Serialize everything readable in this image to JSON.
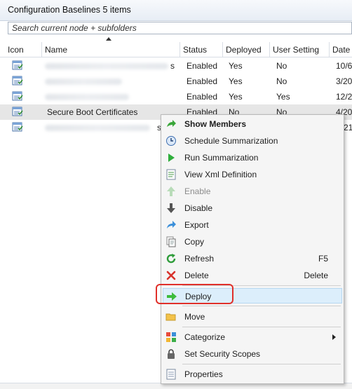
{
  "window": {
    "title": "Configuration Baselines 5 items"
  },
  "search": {
    "placeholder": "Search current node + subfolders"
  },
  "table": {
    "columns": [
      "Icon",
      "Name",
      "Status",
      "Deployed",
      "User Setting",
      "Date"
    ],
    "rows": [
      {
        "name": "",
        "name_suffix": "s",
        "status": "Enabled",
        "deployed": "Yes",
        "user_setting": "No",
        "date": "10/6"
      },
      {
        "name": "",
        "name_suffix": "",
        "status": "Enabled",
        "deployed": "Yes",
        "user_setting": "No",
        "date": "3/20"
      },
      {
        "name": "",
        "name_suffix": "",
        "status": "Enabled",
        "deployed": "Yes",
        "user_setting": "Yes",
        "date": "12/2"
      },
      {
        "name": "Secure Boot Certificates",
        "name_suffix": "",
        "status": "Enabled",
        "deployed": "No",
        "user_setting": "No",
        "date": "4/20"
      },
      {
        "name": "",
        "name_suffix": "s",
        "status": "",
        "deployed": "",
        "user_setting": "",
        "date": "21"
      }
    ]
  },
  "context_menu": {
    "items": [
      {
        "label": "Show Members",
        "icon": "green-arrow-icon",
        "bold": true
      },
      {
        "label": "Schedule Summarization",
        "icon": "clock-icon"
      },
      {
        "label": "Run Summarization",
        "icon": "play-icon"
      },
      {
        "label": "View Xml Definition",
        "icon": "xml-document-icon"
      },
      {
        "label": "Enable",
        "icon": "up-arrow-icon",
        "disabled": true
      },
      {
        "label": "Disable",
        "icon": "down-arrow-icon"
      },
      {
        "label": "Export",
        "icon": "export-arrow-icon"
      },
      {
        "label": "Copy",
        "icon": "copy-icon"
      },
      {
        "label": "Refresh",
        "icon": "refresh-icon",
        "shortcut": "F5"
      },
      {
        "label": "Delete",
        "icon": "delete-x-icon",
        "shortcut": "Delete"
      },
      {
        "label": "Deploy",
        "icon": "deploy-arrow-icon",
        "highlighted": true
      },
      {
        "label": "Move",
        "icon": "folder-icon"
      },
      {
        "label": "Categorize",
        "icon": "categorize-icon",
        "submenu": true
      },
      {
        "label": "Set Security Scopes",
        "icon": "lock-icon"
      },
      {
        "label": "Properties",
        "icon": "properties-icon"
      }
    ]
  },
  "colors": {
    "accent_highlight": "#e0302a",
    "hover_bg": "#dceefb",
    "selected_row": "#e6e6e6"
  }
}
